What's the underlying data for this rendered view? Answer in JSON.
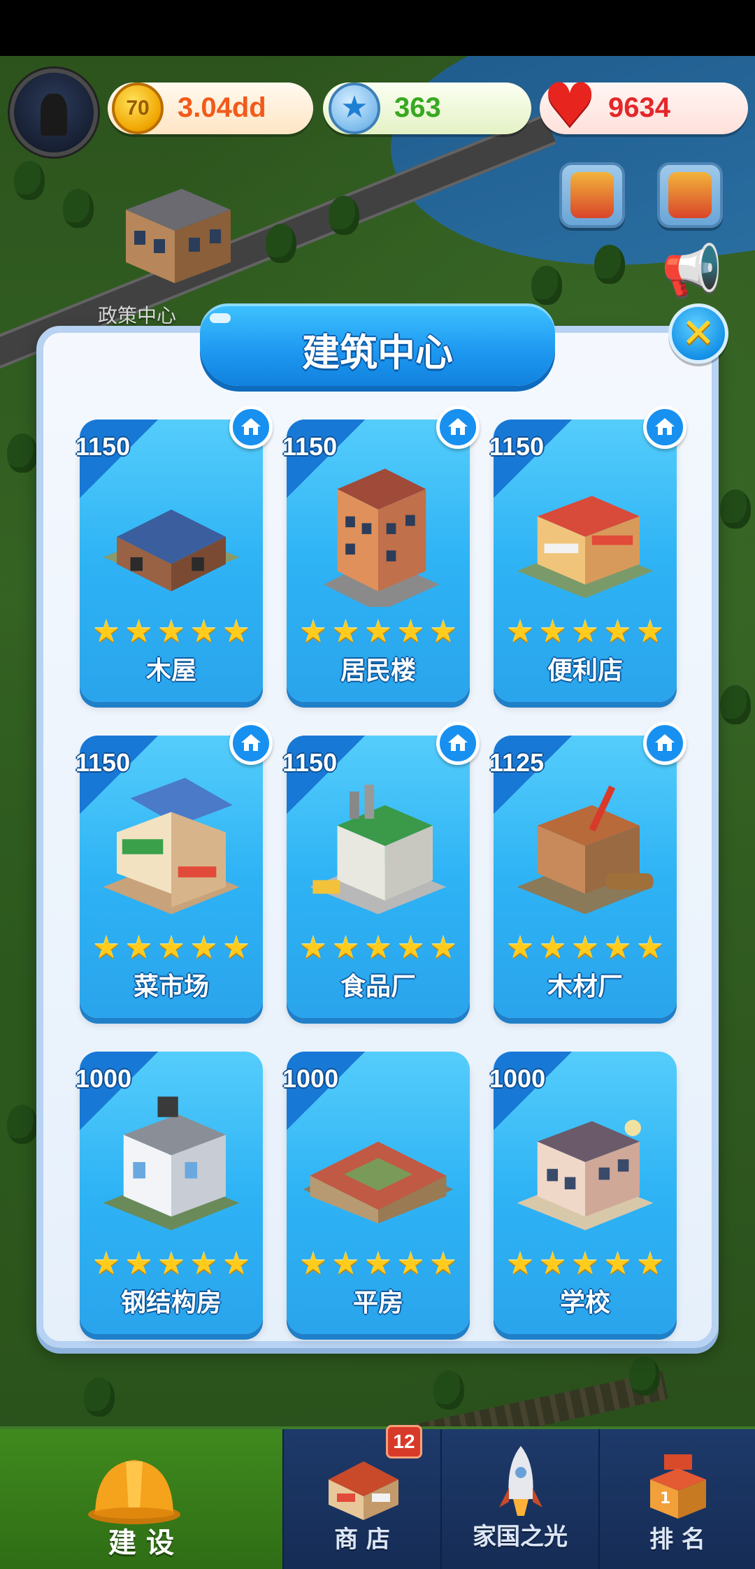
{
  "hud": {
    "coins": "3.04dd",
    "coin_symbol": "70",
    "stars": "363",
    "hearts": "9634"
  },
  "map": {
    "building_label": "政策中心"
  },
  "modal": {
    "title": "建筑中心",
    "close_symbol": "✕"
  },
  "buildings": [
    {
      "price": "1150",
      "name": "木屋",
      "stars": 5,
      "owned": true
    },
    {
      "price": "1150",
      "name": "居民楼",
      "stars": 5,
      "owned": true
    },
    {
      "price": "1150",
      "name": "便利店",
      "stars": 5,
      "owned": true
    },
    {
      "price": "1150",
      "name": "菜市场",
      "stars": 5,
      "owned": true
    },
    {
      "price": "1150",
      "name": "食品厂",
      "stars": 5,
      "owned": true
    },
    {
      "price": "1125",
      "name": "木材厂",
      "stars": 5,
      "owned": true
    },
    {
      "price": "1000",
      "name": "钢结构房",
      "stars": 5,
      "owned": false
    },
    {
      "price": "1000",
      "name": "平房",
      "stars": 5,
      "owned": false
    },
    {
      "price": "1000",
      "name": "学校",
      "stars": 5,
      "owned": false
    }
  ],
  "nav": {
    "items": [
      {
        "label": "建 设",
        "icon": "hard-hat-icon",
        "active": true
      },
      {
        "label": "商 店",
        "icon": "shop-icon",
        "active": false
      },
      {
        "label": "家国之光",
        "icon": "rocket-icon",
        "active": false
      },
      {
        "label": "排 名",
        "icon": "podium-icon",
        "active": false
      }
    ],
    "shop_badge": "12"
  },
  "colors": {
    "card_blue": "#2eb3f5",
    "price_flag": "#1878d6",
    "coin_text": "#f25a1a",
    "star_text": "#37a822",
    "heart_text": "#e4272a",
    "nav_active": "#3f8a1e",
    "nav_bg": "#1e3a6a"
  }
}
